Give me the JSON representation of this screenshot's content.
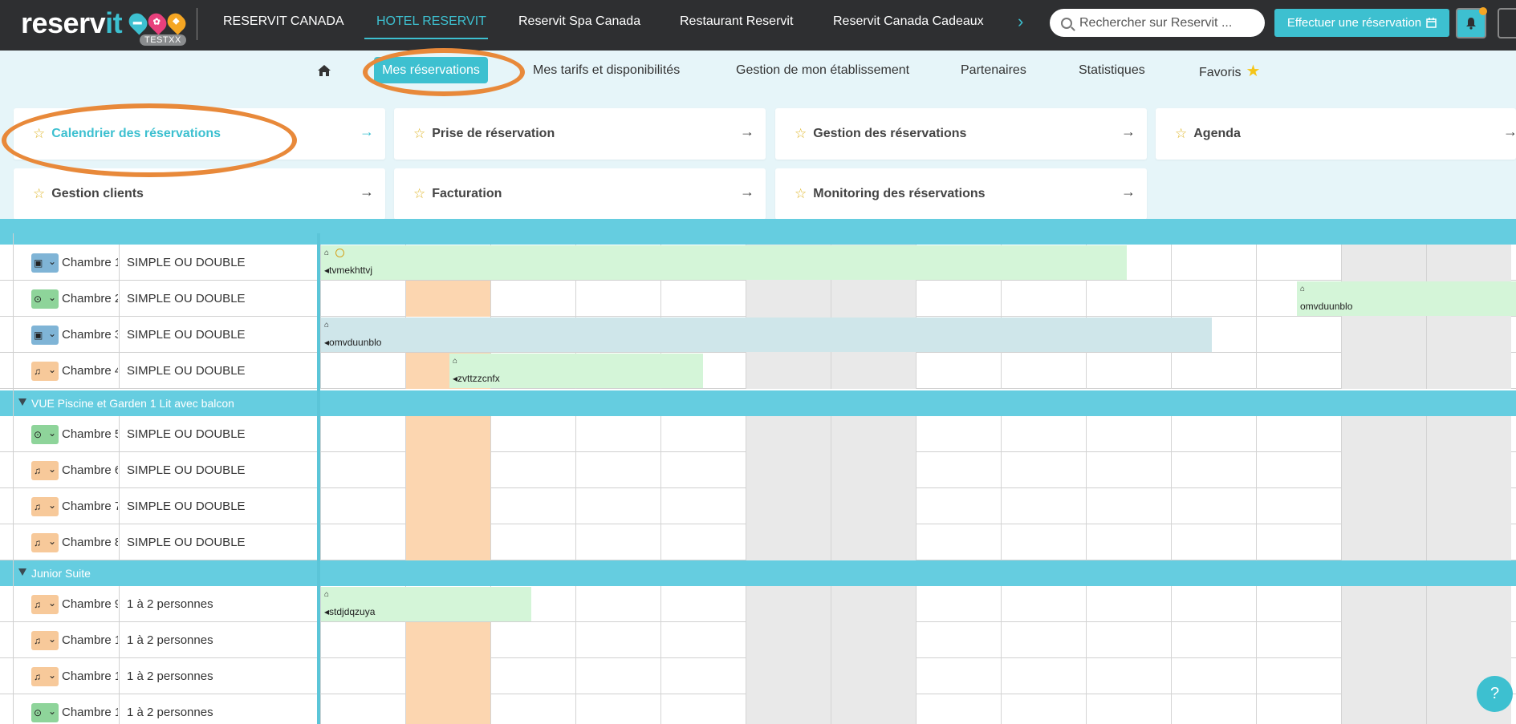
{
  "topbar": {
    "logo_text_a": "reserv",
    "logo_text_b": "it",
    "logo_badge": "TESTXX",
    "nav": [
      {
        "label": "RESERVIT CANADA"
      },
      {
        "label": "HOTEL RESERVIT"
      },
      {
        "label": "Reservit Spa Canada"
      },
      {
        "label": "Restaurant Reservit"
      },
      {
        "label": "Reservit Canada Cadeaux"
      }
    ],
    "search_placeholder": "Rechercher sur Reservit ...",
    "book_button": "Effectuer une réservation",
    "accent": "#3dc0d0"
  },
  "submenu": {
    "items": [
      {
        "label": "Mes réservations"
      },
      {
        "label": "Mes tarifs et disponibilités"
      },
      {
        "label": "Gestion de mon établissement"
      },
      {
        "label": "Partenaires"
      },
      {
        "label": "Statistiques"
      },
      {
        "label": "Favoris"
      }
    ]
  },
  "panel": {
    "cards": [
      {
        "label": "Calendrier des réservations"
      },
      {
        "label": "Prise de réservation"
      },
      {
        "label": "Gestion des réservations"
      },
      {
        "label": "Agenda"
      },
      {
        "label": "Gestion clients"
      },
      {
        "label": "Facturation"
      },
      {
        "label": "Monitoring des réservations"
      }
    ]
  },
  "calendar": {
    "categories": [
      {
        "label": "VUE Piscine et Garden 1 Lit avec balcon"
      },
      {
        "label": "Junior Suite"
      }
    ],
    "rooms": [
      {
        "name": "Chambre 1",
        "type": "SIMPLE OU DOUBLE"
      },
      {
        "name": "Chambre 2",
        "type": "SIMPLE OU DOUBLE"
      },
      {
        "name": "Chambre 3",
        "type": "SIMPLE OU DOUBLE"
      },
      {
        "name": "Chambre 4",
        "type": "SIMPLE OU DOUBLE"
      },
      {
        "name": "Chambre 5",
        "type": "SIMPLE OU DOUBLE"
      },
      {
        "name": "Chambre 6",
        "type": "SIMPLE OU DOUBLE"
      },
      {
        "name": "Chambre 7",
        "type": "SIMPLE OU DOUBLE"
      },
      {
        "name": "Chambre 8",
        "type": "SIMPLE OU DOUBLE"
      },
      {
        "name": "Chambre 9",
        "type": "1 à 2 personnes"
      },
      {
        "name": "Chambre 1",
        "type": "1 à 2 personnes"
      },
      {
        "name": "Chambre 1",
        "type": "1 à 2 personnes"
      },
      {
        "name": "Chambre 1:",
        "type": "1 à 2 personnes"
      }
    ],
    "reservations": [
      {
        "name": "tvmekhttvj",
        "status_color": "#d4f5d8"
      },
      {
        "name": "omvduunblo",
        "status_color": "#d4f5d8"
      },
      {
        "name": "omvduunblo",
        "status_color": "#cfe6ea"
      },
      {
        "name": "zvttzzcnfx",
        "status_color": "#d4f5d8"
      },
      {
        "name": "stdjdqzuya",
        "status_color": "#d4f5d8"
      }
    ]
  },
  "help_label": "?"
}
